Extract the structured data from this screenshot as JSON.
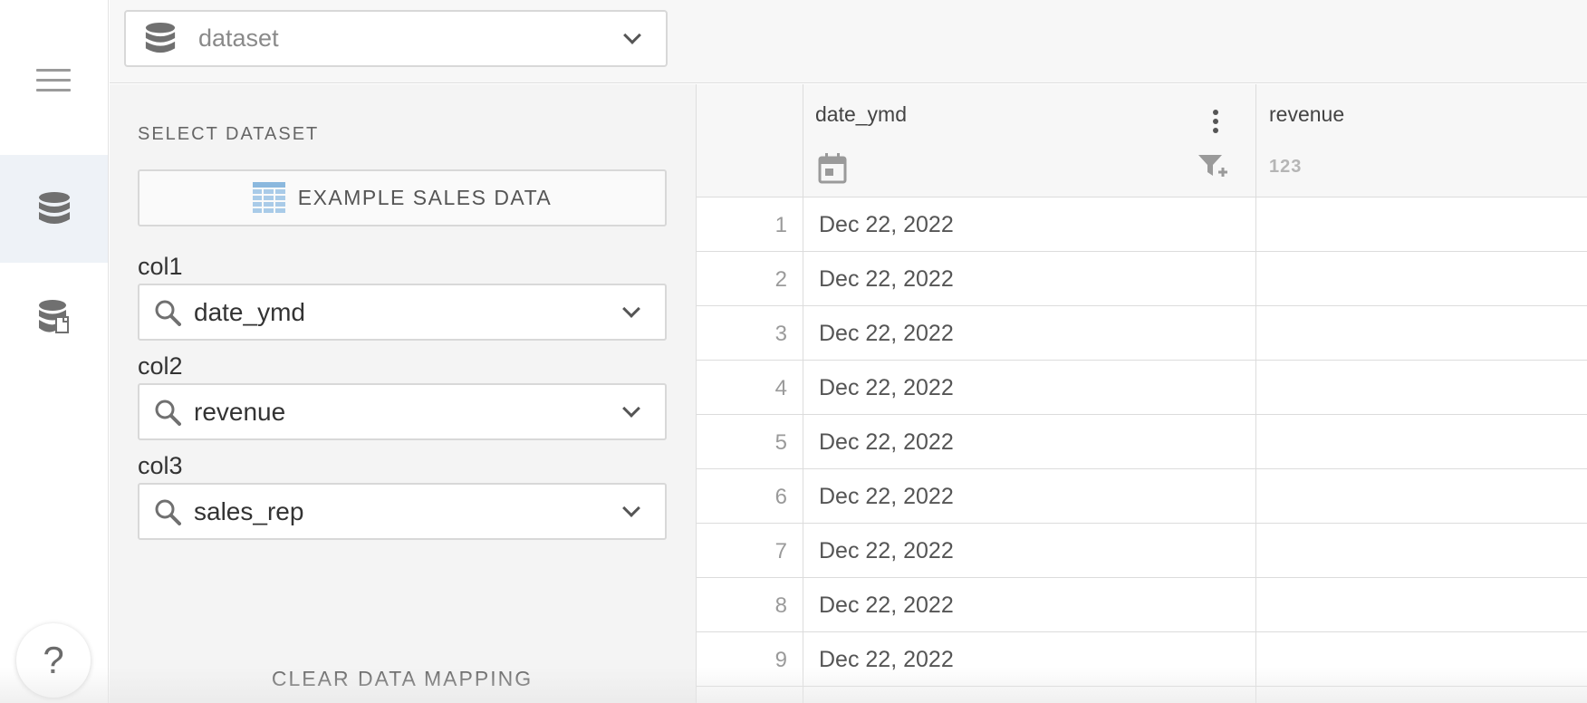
{
  "topbar": {
    "dataset_label": "dataset"
  },
  "rail": {
    "help_label": "?"
  },
  "panel": {
    "section_title": "SELECT DATASET",
    "example_button": "EXAMPLE SALES DATA",
    "fields": [
      {
        "label": "col1",
        "value": "date_ymd"
      },
      {
        "label": "col2",
        "value": "revenue"
      },
      {
        "label": "col3",
        "value": "sales_rep"
      }
    ],
    "clear_button": "CLEAR DATA MAPPING"
  },
  "grid": {
    "columns": [
      {
        "name": "date_ymd",
        "type_icon": "calendar-icon"
      },
      {
        "name": "revenue",
        "type_icon": "number-type-icon",
        "type_label": "123"
      }
    ],
    "rows": [
      {
        "num": "1",
        "date_ymd": "Dec 22, 2022",
        "revenue": ""
      },
      {
        "num": "2",
        "date_ymd": "Dec 22, 2022",
        "revenue": ""
      },
      {
        "num": "3",
        "date_ymd": "Dec 22, 2022",
        "revenue": ""
      },
      {
        "num": "4",
        "date_ymd": "Dec 22, 2022",
        "revenue": ""
      },
      {
        "num": "5",
        "date_ymd": "Dec 22, 2022",
        "revenue": ""
      },
      {
        "num": "6",
        "date_ymd": "Dec 22, 2022",
        "revenue": ""
      },
      {
        "num": "7",
        "date_ymd": "Dec 22, 2022",
        "revenue": ""
      },
      {
        "num": "8",
        "date_ymd": "Dec 22, 2022",
        "revenue": ""
      },
      {
        "num": "9",
        "date_ymd": "Dec 22, 2022",
        "revenue": ""
      }
    ]
  },
  "colors": {
    "accent_light": "#eef2f7",
    "icon_gray": "#707070",
    "table_icon_blue": "#8bb8de"
  }
}
